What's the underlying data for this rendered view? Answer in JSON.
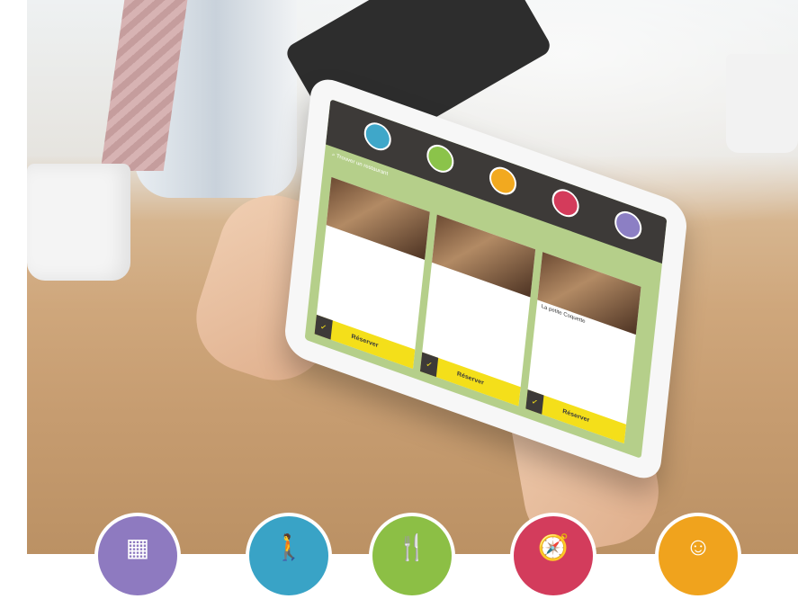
{
  "tablet_app": {
    "nav": [
      {
        "label": "",
        "color": "#3fa7c9"
      },
      {
        "label": "",
        "color": "#8bc34a"
      },
      {
        "label": "",
        "color": "#f2a91f"
      },
      {
        "label": "",
        "color": "#d43b5b"
      },
      {
        "label": "",
        "color": "#8c7fc4"
      }
    ],
    "search_placeholder": "Trouver un restaurant",
    "cards": [
      {
        "name": "",
        "address": "",
        "cuisine": "",
        "reserve": "Réserver"
      },
      {
        "name": "",
        "address": "",
        "cuisine": "",
        "reserve": "Réserver"
      },
      {
        "name": "La petite Coquette",
        "address": "",
        "cuisine": "",
        "reserve": "Réserver"
      }
    ]
  },
  "bottom_icons": [
    {
      "name": "ticket-icon",
      "color": "#8e7ac0"
    },
    {
      "name": "walking-person-icon",
      "color": "#39a3c6"
    },
    {
      "name": "fork-knife-icon",
      "color": "#8cbf45"
    },
    {
      "name": "compass-icon",
      "color": "#d33c5c"
    },
    {
      "name": "concierge-icon",
      "color": "#f0a31d"
    }
  ]
}
